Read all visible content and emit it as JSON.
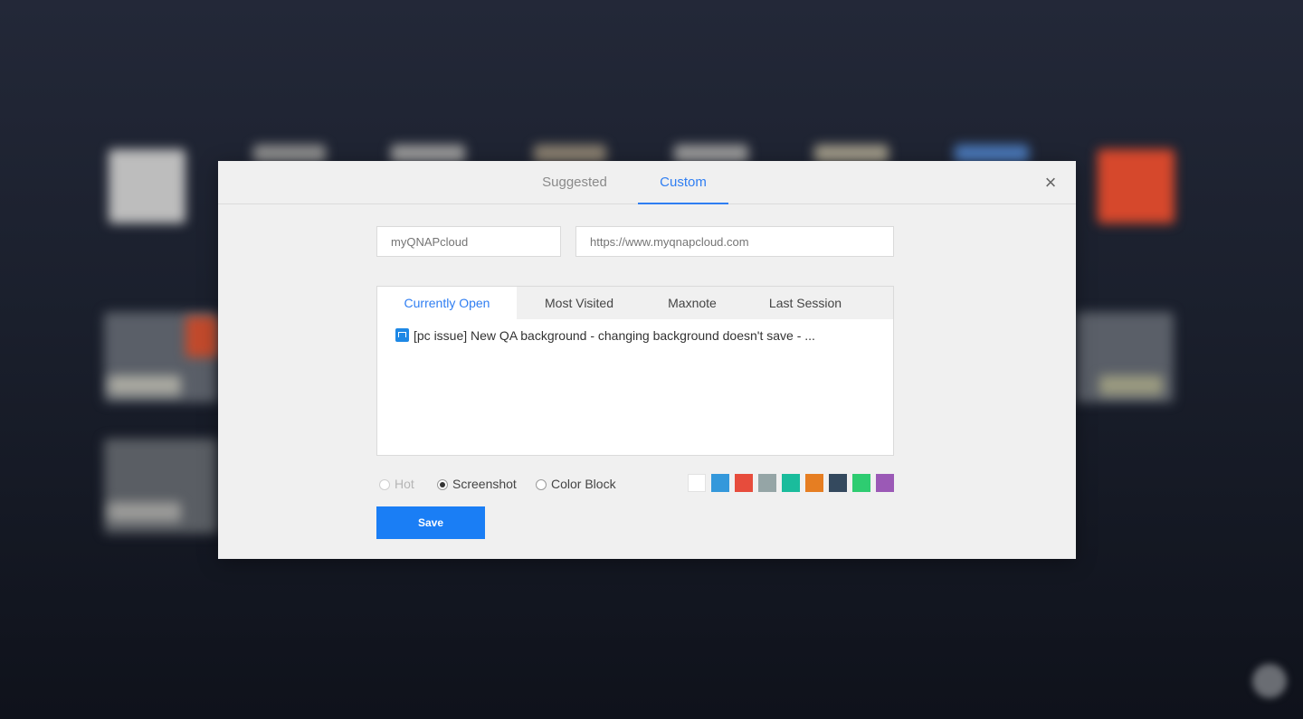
{
  "dialog": {
    "tabs": [
      {
        "label": "Suggested",
        "active": false
      },
      {
        "label": "Custom",
        "active": true
      }
    ],
    "close_icon": "close-icon",
    "name_field": {
      "value": "",
      "placeholder": "myQNAPcloud"
    },
    "url_field": {
      "value": "",
      "placeholder": "https://www.myqnapcloud.com"
    },
    "source_tabs": [
      {
        "label": "Currently Open",
        "active": true
      },
      {
        "label": "Most Visited",
        "active": false
      },
      {
        "label": "Maxnote",
        "active": false
      },
      {
        "label": "Last Session",
        "active": false
      }
    ],
    "items": [
      {
        "icon": "maxthon-favicon-icon",
        "title": "[pc issue] New QA background - changing background doesn't save - ..."
      }
    ],
    "display_options": [
      {
        "label": "Hot",
        "checked": false,
        "disabled": true
      },
      {
        "label": "Screenshot",
        "checked": true,
        "disabled": false
      },
      {
        "label": "Color Block",
        "checked": false,
        "disabled": false
      }
    ],
    "colors": [
      "#ffffff",
      "#3498db",
      "#e74c3c",
      "#95a5a6",
      "#1abc9c",
      "#e67e22",
      "#34495e",
      "#2ecc71",
      "#9b59b6"
    ],
    "save_label": "Save"
  },
  "theme": {
    "accent": "#2f7ef2",
    "save_button": "#1a7ef5"
  }
}
